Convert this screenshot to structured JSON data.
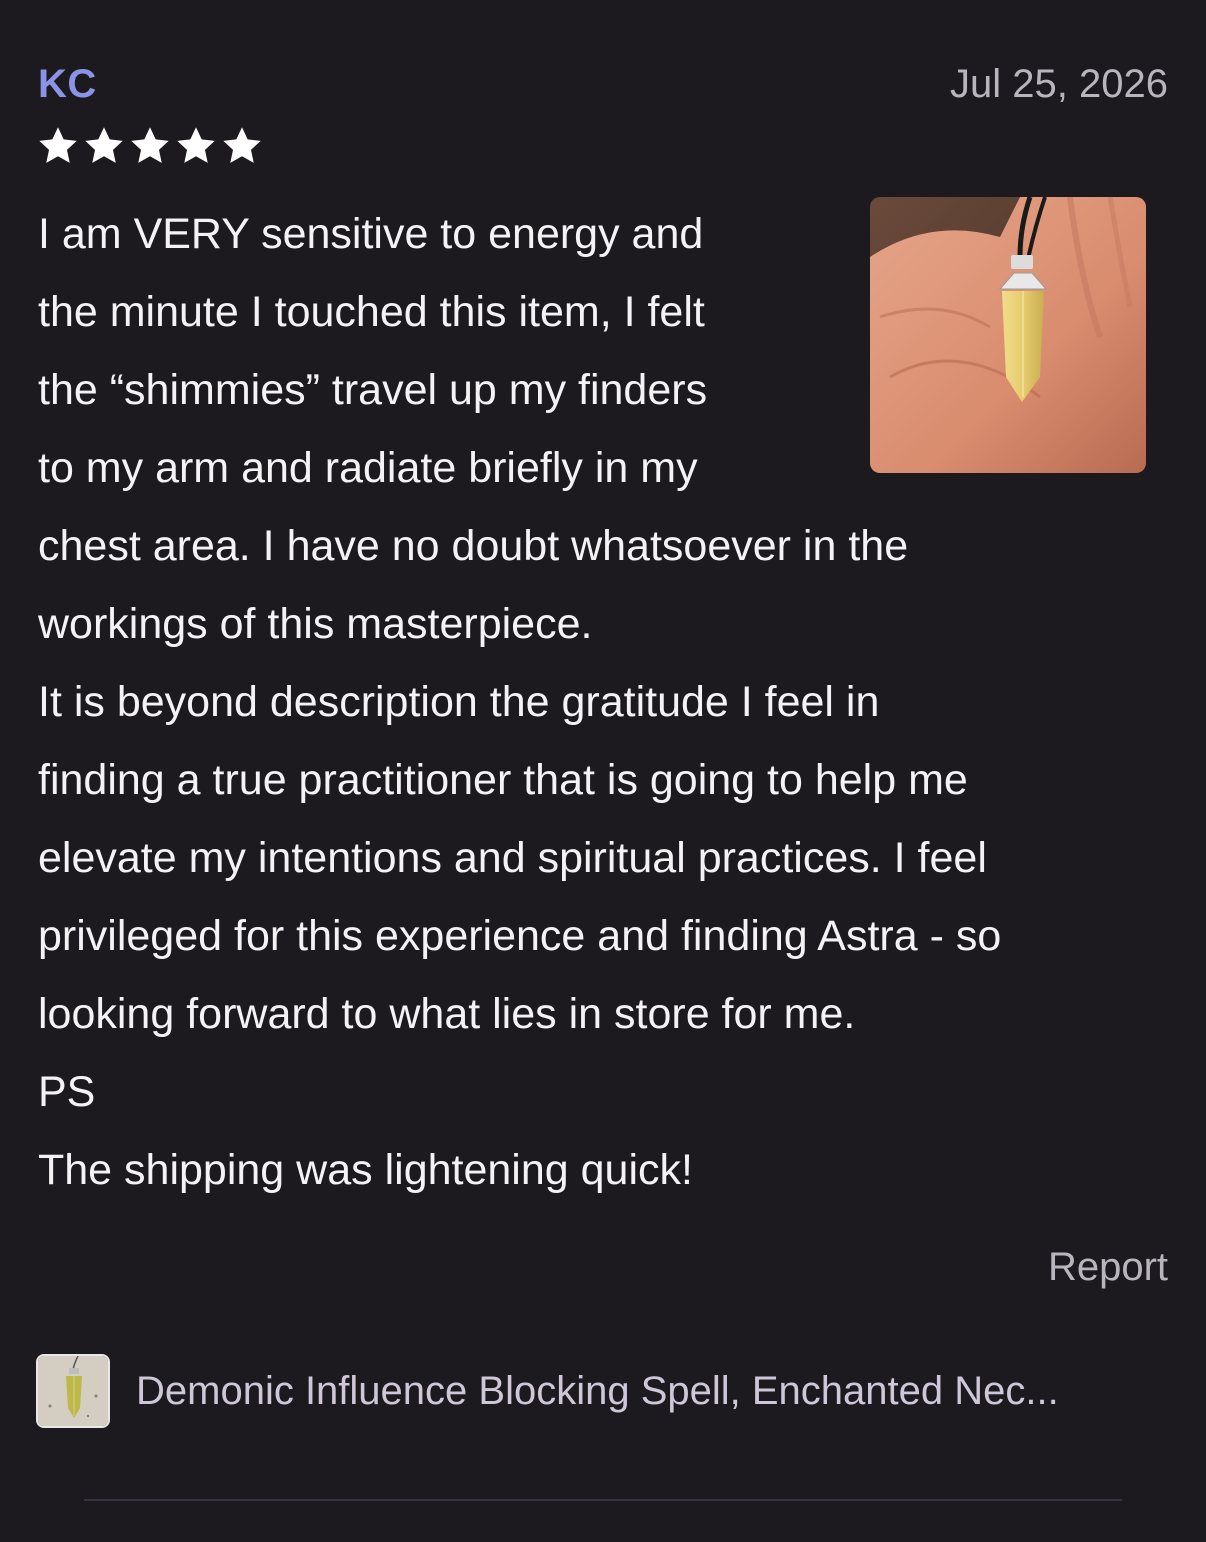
{
  "review": {
    "reviewer": "KC",
    "date": "Jul 25, 2026",
    "rating": 5,
    "rating_max": 5,
    "body_lines": [
      "I am VERY sensitive to energy and",
      "the minute I touched this item, I felt",
      "the “shimmies” travel up my finders",
      "to my arm and radiate briefly in my",
      "chest area. I have no doubt whatsoever in the",
      "workings of this masterpiece.",
      "It is beyond description the gratitude I feel in",
      "finding a true practitioner that is going to help me",
      "elevate my intentions and spiritual practices. I feel",
      "privileged for this experience and finding Astra - so",
      "looking forward to what lies in store for me.",
      "PS",
      "The shipping was lightening quick!"
    ],
    "report_label": "Report",
    "photo_icon": "pendant-in-hand-photo"
  },
  "product": {
    "name": "Demonic Influence Blocking Spell, Enchanted Nec...",
    "thumb_icon": "pendant-thumbnail"
  },
  "colors": {
    "background": "#1c1a1f",
    "reviewer_name": "#8a93e8",
    "star": "#ffffff",
    "secondary_text": "#b9b5bd",
    "product_text": "#cfc6d8"
  }
}
